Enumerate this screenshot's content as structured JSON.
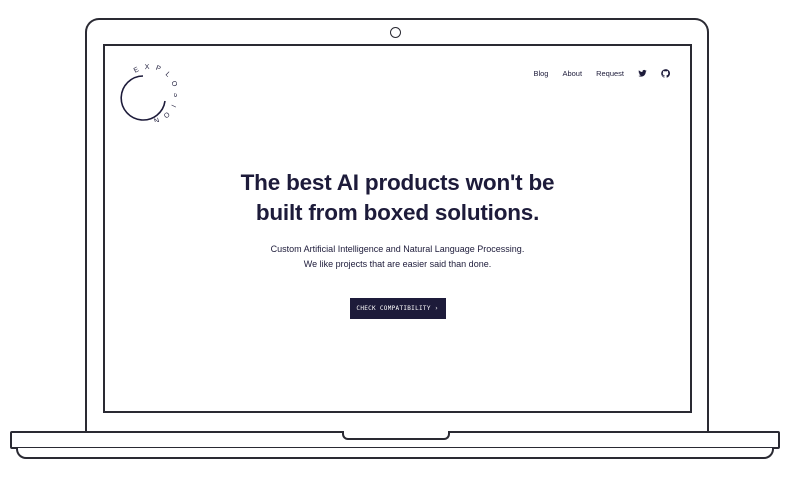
{
  "brand": {
    "name": "EXPLOSION",
    "letters": [
      "E",
      "X",
      "P",
      "L",
      "O",
      "S",
      "I",
      "O",
      "N"
    ]
  },
  "nav": {
    "links": [
      "Blog",
      "About",
      "Request"
    ],
    "icons": [
      "twitter-icon",
      "github-icon"
    ]
  },
  "hero": {
    "headline_line1": "The best AI products won't be",
    "headline_line2": "built from boxed solutions.",
    "sub_line1": "Custom Artificial Intelligence and Natural Language Processing.",
    "sub_line2": "We like projects that are easier said than done.",
    "cta_label": "CHECK COMPATIBILITY ›"
  },
  "colors": {
    "brand_dark": "#1d1b3a",
    "background": "#ffffff",
    "frame": "#2a2a33"
  }
}
